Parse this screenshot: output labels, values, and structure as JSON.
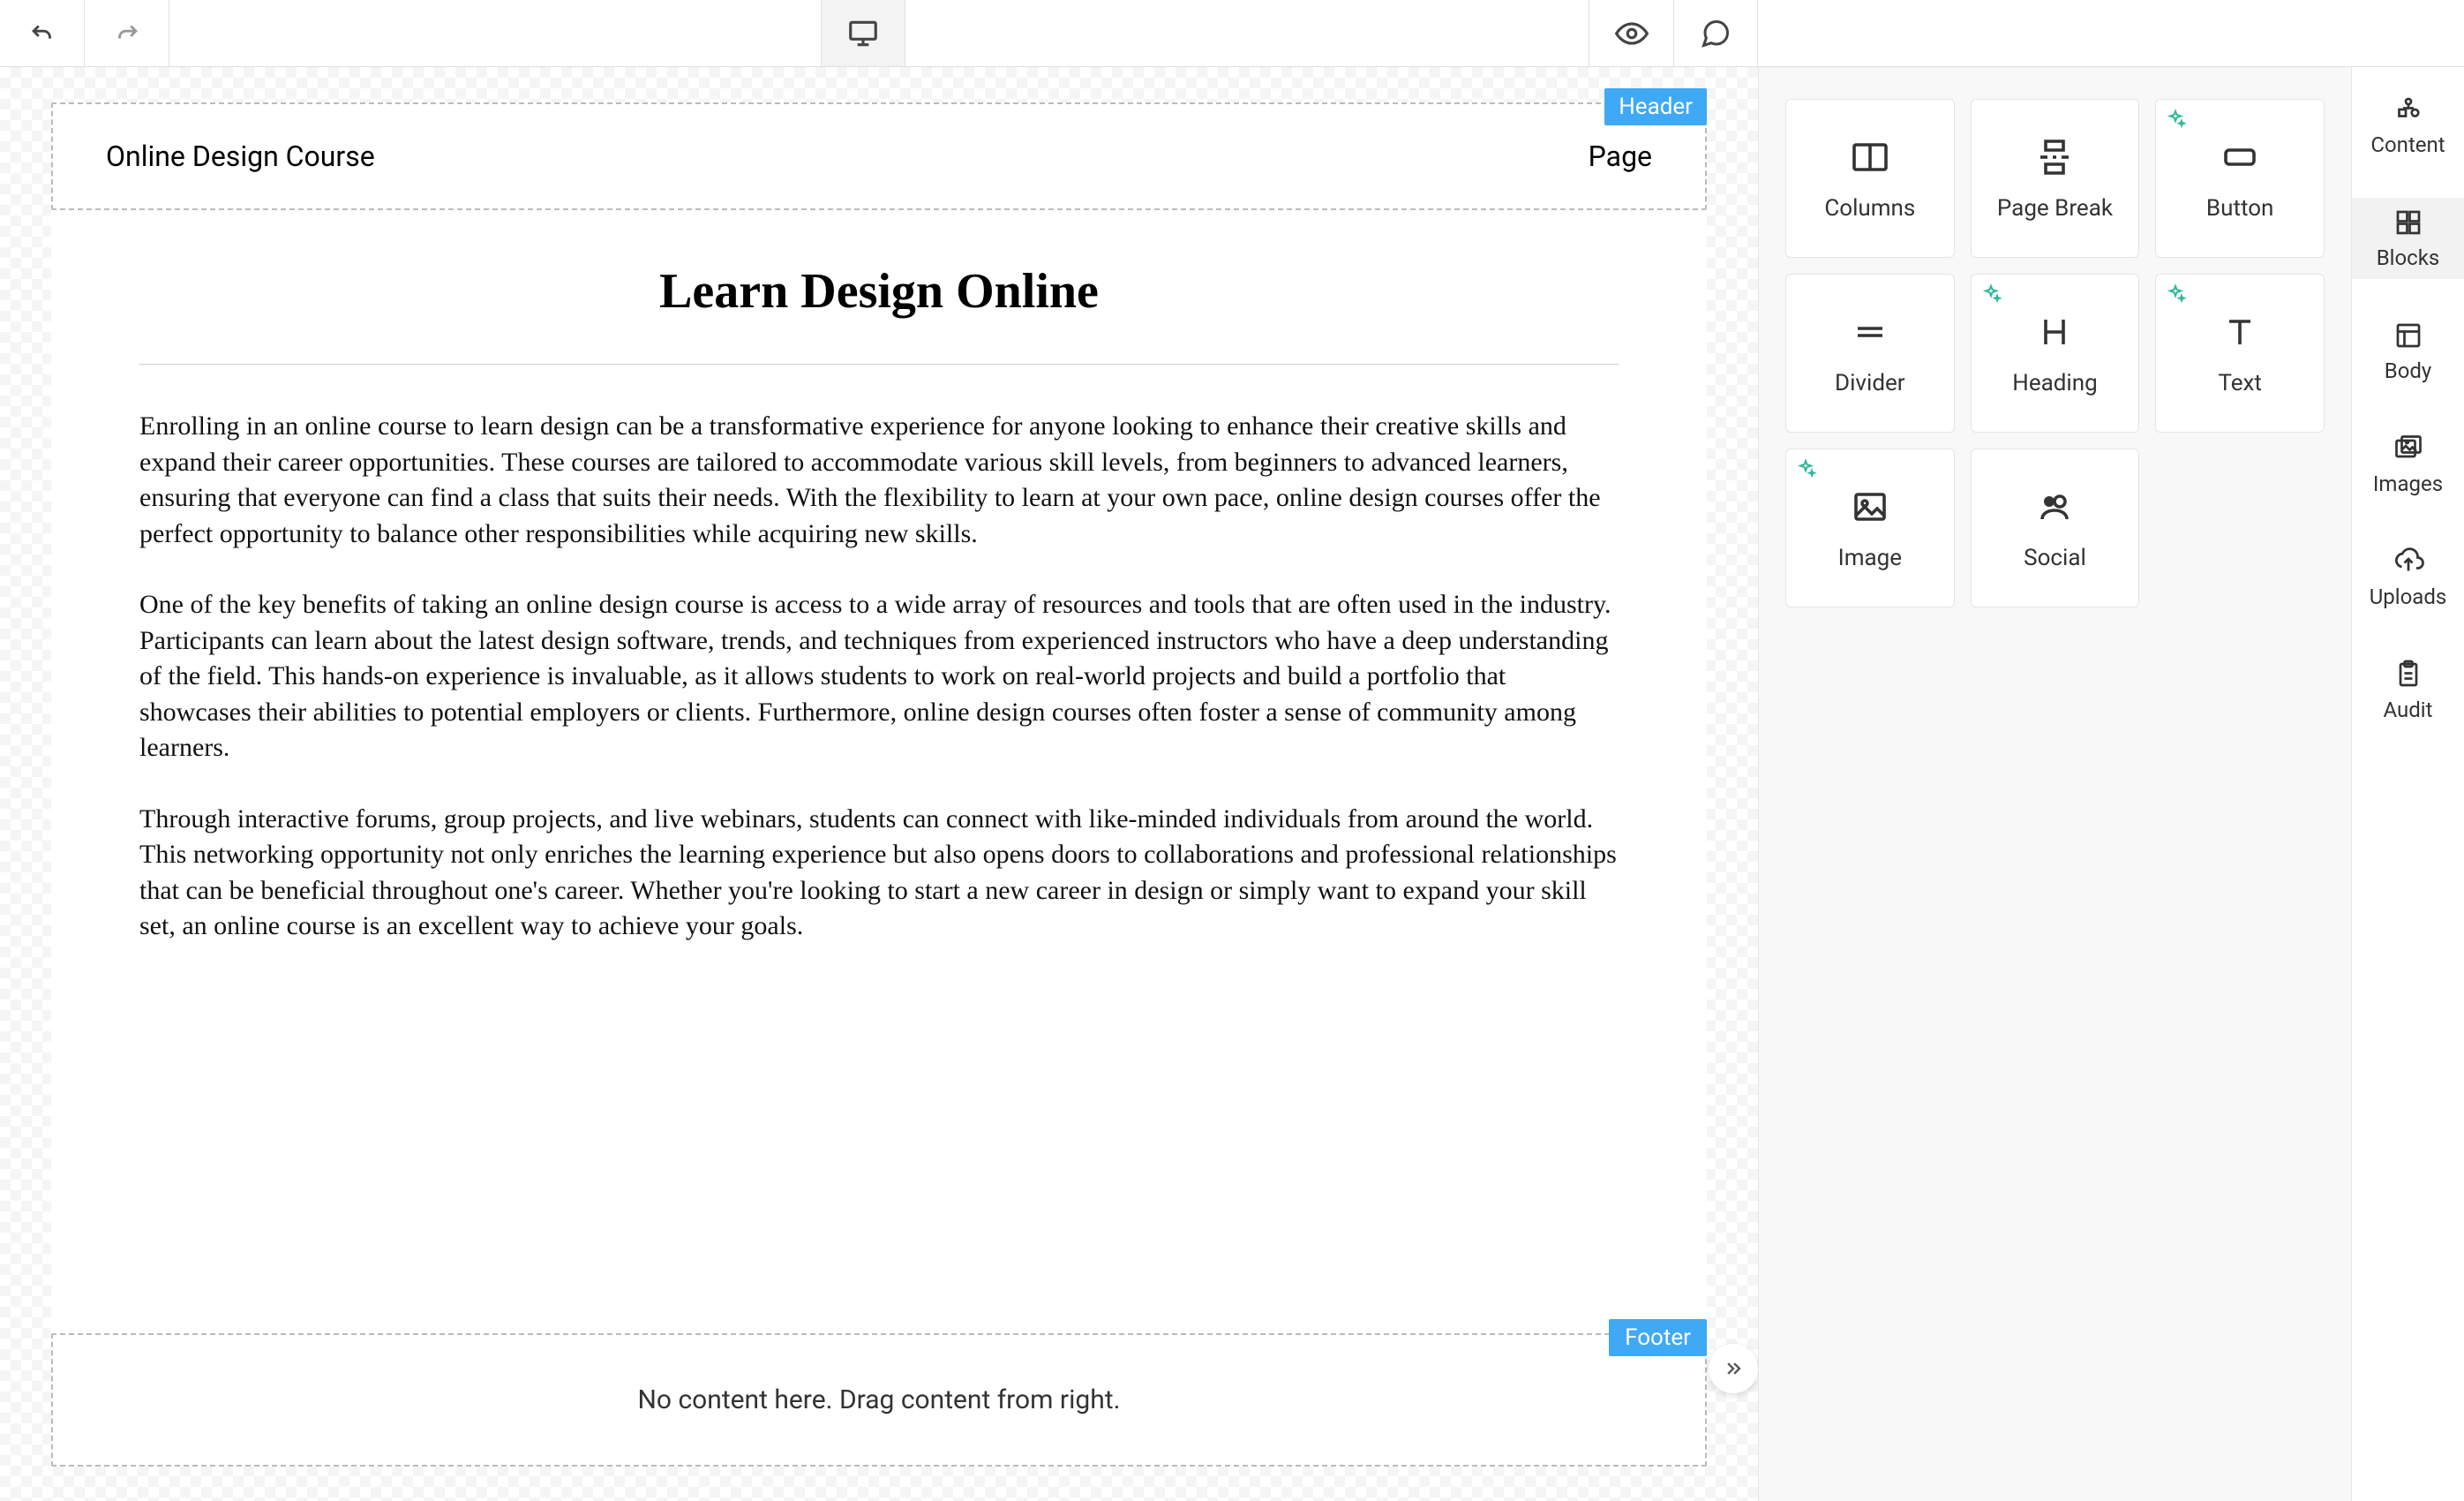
{
  "topbar": {
    "undo": "undo",
    "redo": "redo",
    "device": "desktop",
    "preview": "preview",
    "comment": "comment"
  },
  "header": {
    "tag": "Header",
    "site_title": "Online Design Course",
    "page_label": "Page"
  },
  "content": {
    "heading": "Learn Design Online",
    "p1": "Enrolling in an online course to learn design can be a transformative experience for anyone looking to enhance their creative skills and expand their career opportunities. These courses are tailored to accommodate various skill levels, from beginners to advanced learners, ensuring that everyone can find a class that suits their needs. With the flexibility to learn at your own pace, online design courses offer the perfect opportunity to balance other responsibilities while acquiring new skills.",
    "p2": "One of the key benefits of taking an online design course is access to a wide array of resources and tools that are often used in the industry. Participants can learn about the latest design software, trends, and techniques from experienced instructors who have a deep understanding of the field. This hands-on experience is invaluable, as it allows students to work on real-world projects and build a portfolio that showcases their abilities to potential employers or clients. Furthermore, online design courses often foster a sense of community among learners.",
    "p3": "Through interactive forums, group projects, and live webinars, students can connect with like-minded individuals from around the world. This networking opportunity not only enriches the learning experience but also opens doors to collaborations and professional relationships that can be beneficial throughout one's career. Whether you're looking to start a new career in design or simply want to expand your skill set, an online course is an excellent way to achieve your goals."
  },
  "footer": {
    "tag": "Footer",
    "empty_text": "No content here. Drag content from right."
  },
  "blocks": {
    "items": [
      {
        "label": "Columns",
        "icon": "columns",
        "ai": false
      },
      {
        "label": "Page Break",
        "icon": "page-break",
        "ai": false
      },
      {
        "label": "Button",
        "icon": "button",
        "ai": true
      },
      {
        "label": "Divider",
        "icon": "divider",
        "ai": false
      },
      {
        "label": "Heading",
        "icon": "heading",
        "ai": true
      },
      {
        "label": "Text",
        "icon": "text",
        "ai": true
      },
      {
        "label": "Image",
        "icon": "image",
        "ai": true
      },
      {
        "label": "Social",
        "icon": "social",
        "ai": false
      }
    ]
  },
  "rail": {
    "items": [
      {
        "label": "Content",
        "icon": "content"
      },
      {
        "label": "Blocks",
        "icon": "blocks"
      },
      {
        "label": "Body",
        "icon": "body"
      },
      {
        "label": "Images",
        "icon": "images"
      },
      {
        "label": "Uploads",
        "icon": "uploads"
      },
      {
        "label": "Audit",
        "icon": "audit"
      }
    ],
    "active_index": 1
  },
  "colors": {
    "accent": "#3fa9f5",
    "ai": "#2fb89a"
  }
}
